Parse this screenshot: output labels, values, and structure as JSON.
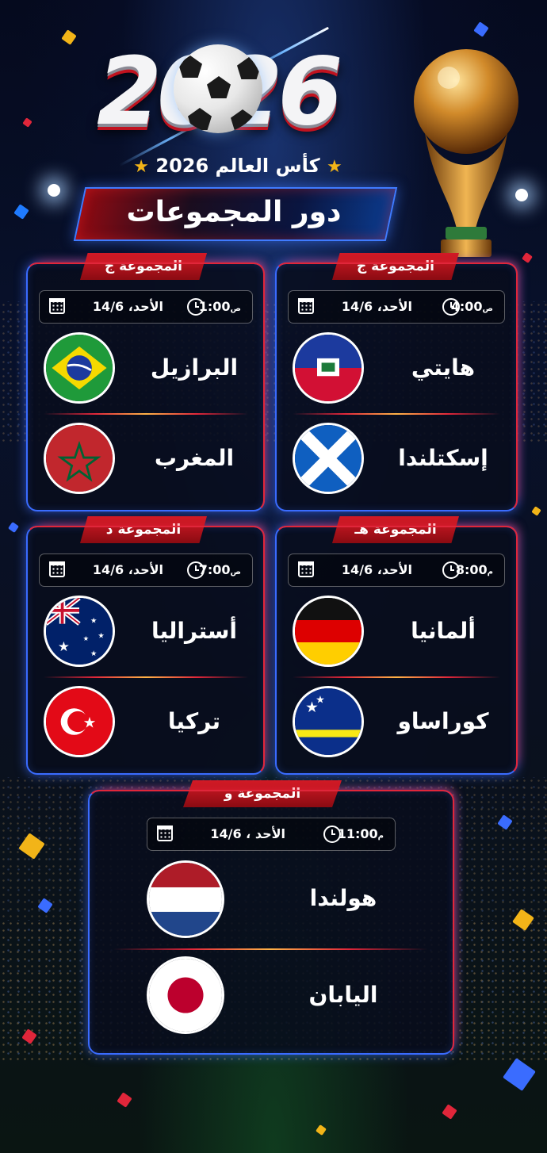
{
  "header": {
    "logo_year": "2026",
    "subtitle": "كأس العالم 2026",
    "stage_title": "دور المجموعات"
  },
  "colors": {
    "accent_blue": "#3a6cff",
    "accent_red": "#e0263a",
    "gold": "#f2b418",
    "background": "#08112b"
  },
  "matches": [
    {
      "group": "المجموعة ج",
      "time": "4:00",
      "ampm": "ص",
      "date": "الأحد، 14/6",
      "team_a": {
        "name": "هايتي",
        "flag": "haiti-flag"
      },
      "team_b": {
        "name": "إسكتلندا",
        "flag": "scotland-flag"
      }
    },
    {
      "group": "المجموعة ج",
      "time": "1:00",
      "ampm": "ص",
      "date": "الأحد، 14/6",
      "team_a": {
        "name": "البرازيل",
        "flag": "brazil-flag"
      },
      "team_b": {
        "name": "المغرب",
        "flag": "morocco-flag"
      }
    },
    {
      "group": "المجموعة هـ",
      "time": "8:00",
      "ampm": "م",
      "date": "الأحد، 14/6",
      "team_a": {
        "name": "ألمانيا",
        "flag": "germany-flag"
      },
      "team_b": {
        "name": "كوراساو",
        "flag": "curacao-flag"
      }
    },
    {
      "group": "المجموعة د",
      "time": "7:00",
      "ampm": "ص",
      "date": "الأحد، 14/6",
      "team_a": {
        "name": "أستراليا",
        "flag": "australia-flag"
      },
      "team_b": {
        "name": "تركيا",
        "flag": "turkey-flag"
      }
    },
    {
      "group": "المجموعة و",
      "time": "11:00",
      "ampm": "م",
      "date": "الأحد ، 14/6",
      "team_a": {
        "name": "هولندا",
        "flag": "netherlands-flag"
      },
      "team_b": {
        "name": "اليابان",
        "flag": "japan-flag"
      }
    }
  ]
}
